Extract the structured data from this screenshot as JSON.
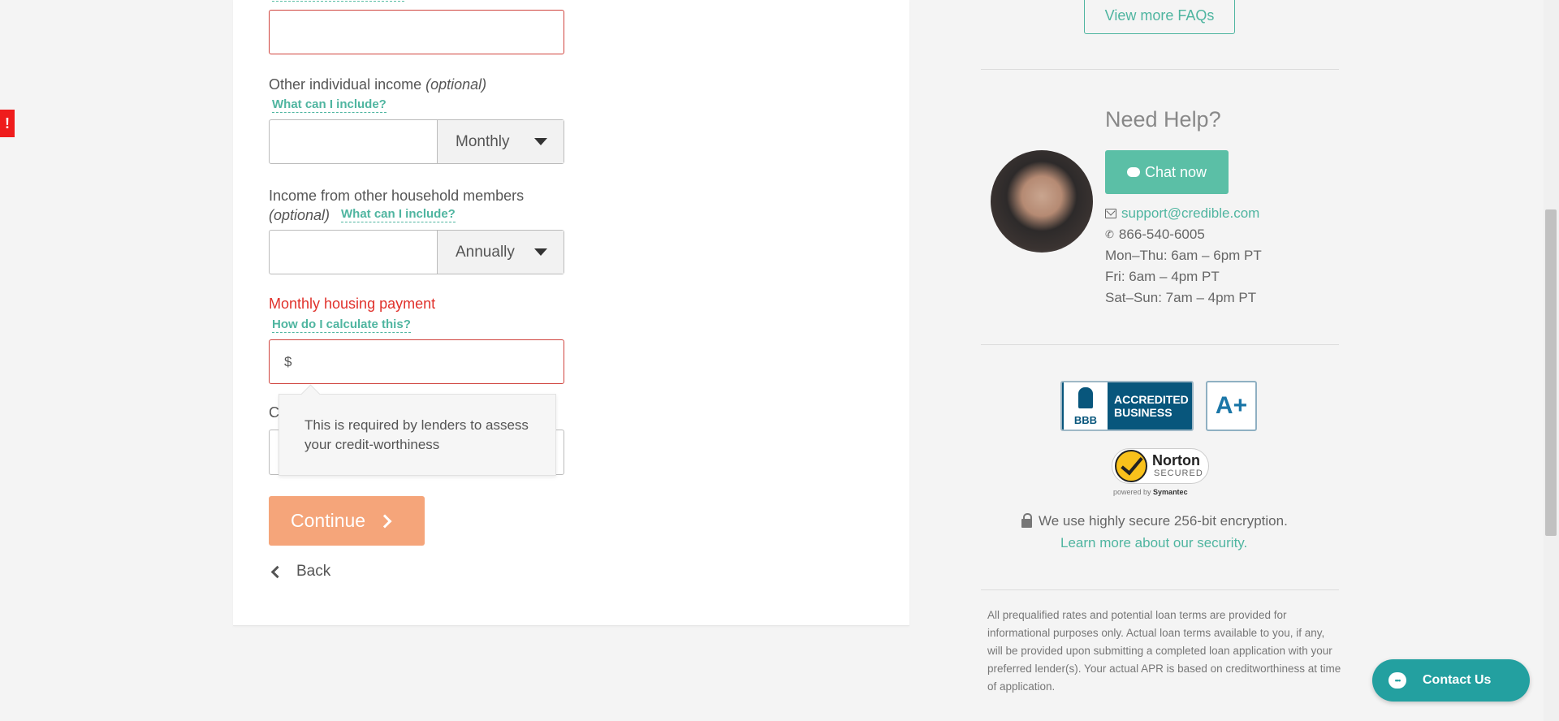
{
  "error_flag": "!",
  "form": {
    "other_income": {
      "label": "Other individual income",
      "optional": "(optional)",
      "help": "What can I include?",
      "frequency": "Monthly"
    },
    "household_income": {
      "label": "Income from other household members",
      "optional": "(optional)",
      "help": "What can I include?",
      "frequency": "Annually"
    },
    "housing_payment": {
      "label": "Monthly housing payment",
      "help": "How do I calculate this?",
      "prefix": "$",
      "tooltip": "This is required by lenders to assess your credit-worthiness"
    },
    "partially_hidden_label": "C",
    "continue_label": "Continue",
    "back_label": "Back"
  },
  "sidebar": {
    "faq_button": "View more FAQs",
    "help_title": "Need Help?",
    "chat_button": "Chat now",
    "email": "support@credible.com",
    "phone": "866-540-6005",
    "hours": [
      "Mon–Thu: 6am – 6pm PT",
      "Fri: 6am – 4pm PT",
      "Sat–Sun: 7am – 4pm PT"
    ],
    "bbb": {
      "logo": "BBB",
      "line1": "ACCREDITED",
      "line2": "BUSINESS",
      "grade": "A+"
    },
    "norton": {
      "name": "Norton",
      "secured": "SECURED",
      "powered_by": "powered by",
      "vendor": "Symantec"
    },
    "encryption_text": "We use highly secure 256-bit encryption.",
    "security_link": "Learn more about our security.",
    "disclaimer": "All prequalified rates and potential loan terms are provided for informational purposes only. Actual loan terms available to you, if any, will be provided upon submitting a completed loan application with your preferred lender(s). Your actual APR is based on creditworthiness at time of application."
  },
  "contact_fab": "Contact Us",
  "colors": {
    "accent": "#5bbfa6",
    "error": "#e0312b",
    "continue": "#f5a57a",
    "fab": "#23a0a0"
  }
}
